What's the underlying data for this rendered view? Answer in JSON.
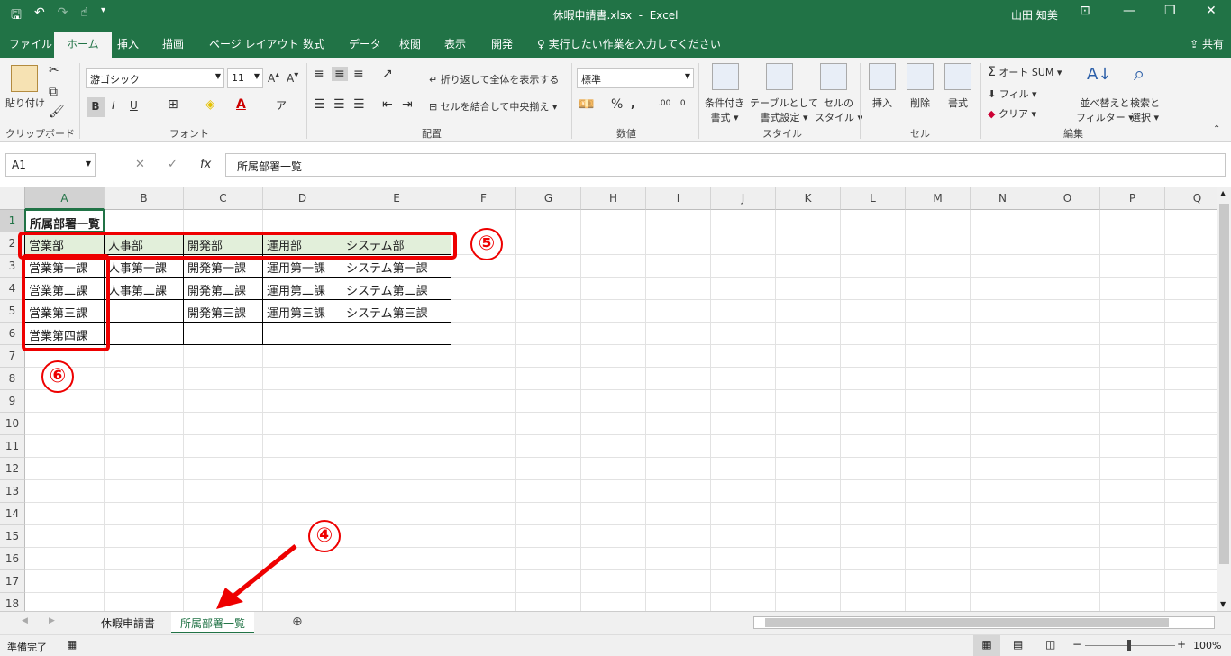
{
  "titlebar": {
    "file": "休暇申請書.xlsx",
    "sep": "-",
    "app": "Excel",
    "user": "山田 知美"
  },
  "tabs": {
    "file": "ファイル",
    "home": "ホーム",
    "insert": "挿入",
    "draw": "描画",
    "layout": "ページ レイアウト",
    "formulas": "数式",
    "data": "データ",
    "review": "校閲",
    "view": "表示",
    "developer": "開発",
    "tell_me": "実行したい作業を入力してください",
    "share": "共有"
  },
  "ribbon": {
    "paste": "貼り付け",
    "clipboard": "クリップボード",
    "font_name": "游ゴシック",
    "font_size": "11",
    "font_group": "フォント",
    "wrap_text": "折り返して全体を表示する",
    "merge_center": "セルを結合して中央揃え",
    "alignment_group": "配置",
    "number_format": "標準",
    "number_group": "数値",
    "cond_format_1": "条件付き",
    "cond_format_2": "書式",
    "table_format_1": "テーブルとして",
    "table_format_2": "書式設定",
    "cell_styles_1": "セルの",
    "cell_styles_2": "スタイル",
    "styles_group": "スタイル",
    "insert": "挿入",
    "delete": "削除",
    "format": "書式",
    "cells_group": "セル",
    "autosum": "オート SUM",
    "fill": "フィル",
    "clear": "クリア",
    "sort_filter_1": "並べ替えと",
    "sort_filter_2": "フィルター",
    "find_select_1": "検索と",
    "find_select_2": "選択",
    "editing_group": "編集"
  },
  "formula_bar": {
    "name_box": "A1",
    "fx": "fx",
    "content": "所属部署一覧"
  },
  "columns": [
    "A",
    "B",
    "C",
    "D",
    "E",
    "F",
    "G",
    "H",
    "I",
    "J",
    "K",
    "L",
    "M",
    "N",
    "O",
    "P",
    "Q"
  ],
  "rows": [
    "1",
    "2",
    "3",
    "4",
    "5",
    "6",
    "7",
    "8",
    "9",
    "10",
    "11",
    "12",
    "13",
    "14",
    "15",
    "16",
    "17",
    "18"
  ],
  "cells": {
    "A1": "所属部署一覧",
    "A2": "営業部",
    "B2": "人事部",
    "C2": "開発部",
    "D2": "運用部",
    "E2": "システム部",
    "A3": "営業第一課",
    "B3": "人事第一課",
    "C3": "開発第一課",
    "D3": "運用第一課",
    "E3": "システム第一課",
    "A4": "営業第二課",
    "B4": "人事第二課",
    "C4": "開発第二課",
    "D4": "運用第二課",
    "E4": "システム第二課",
    "A5": "営業第三課",
    "C5": "開発第三課",
    "D5": "運用第三課",
    "E5": "システム第三課",
    "A6": "営業第四課"
  },
  "sheets": {
    "sheet1": "休暇申請書",
    "sheet2": "所属部署一覧"
  },
  "status": {
    "ready": "準備完了",
    "zoom": "100%"
  },
  "annotations": {
    "n4": "④",
    "n5": "⑤",
    "n6": "⑥"
  },
  "colors": {
    "excel_green": "#217346",
    "header_fill": "#e2efda",
    "annotation_red": "#e00000"
  }
}
